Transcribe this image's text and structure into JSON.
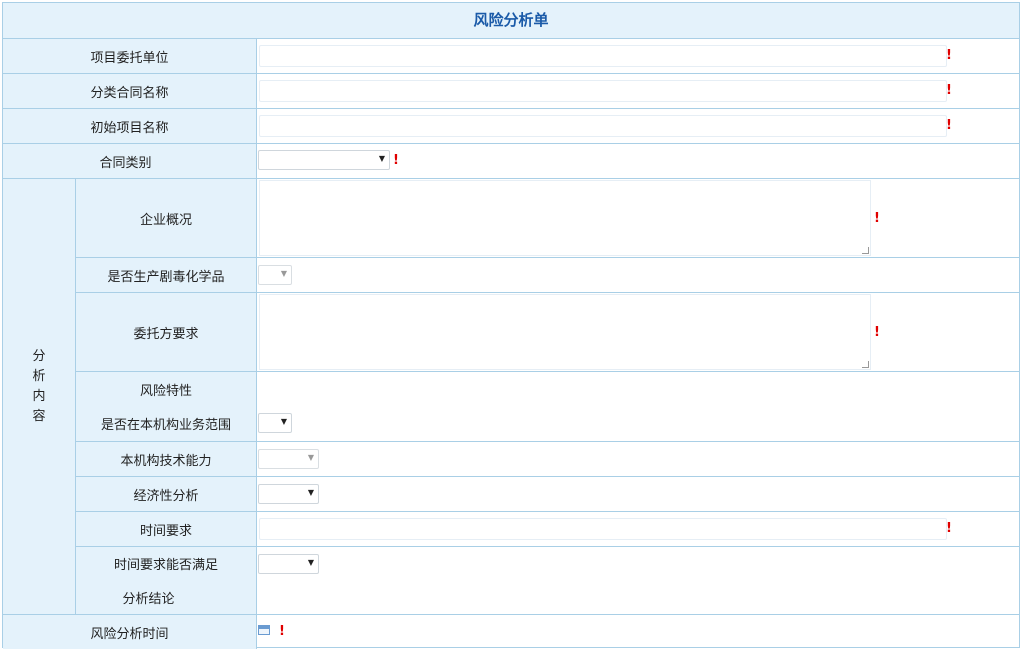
{
  "form": {
    "title": "风险分析单",
    "group_label": "分析内容",
    "required_mark": "!",
    "fields": {
      "client_unit": {
        "label": "项目委托单位",
        "value": ""
      },
      "contract_name": {
        "label": "分类合同名称",
        "value": ""
      },
      "initial_project": {
        "label": "初始项目名称",
        "value": ""
      },
      "contract_type": {
        "label": "合同类别",
        "value": ""
      },
      "company_overview": {
        "label": "企业概况",
        "value": ""
      },
      "hazardous_chem": {
        "label": "是否生产剧毒化学品",
        "value": ""
      },
      "client_requirements": {
        "label": "委托方要求",
        "value": ""
      },
      "risk_features": {
        "label": "风险特性"
      },
      "in_business_scope": {
        "label": "是否在本机构业务范围",
        "value": ""
      },
      "tech_capability": {
        "label": "本机构技术能力",
        "value": ""
      },
      "economic_analysis": {
        "label": "经济性分析",
        "value": ""
      },
      "time_requirement": {
        "label": "时间要求",
        "value": ""
      },
      "time_satisfied": {
        "label": "时间要求能否满足",
        "value": ""
      },
      "conclusion": {
        "label": "分析结论"
      },
      "analysis_time": {
        "label": "风险分析时间",
        "value": ""
      }
    }
  },
  "icons": {
    "dropdown": "triangle-down",
    "calendar": "calendar-icon"
  }
}
